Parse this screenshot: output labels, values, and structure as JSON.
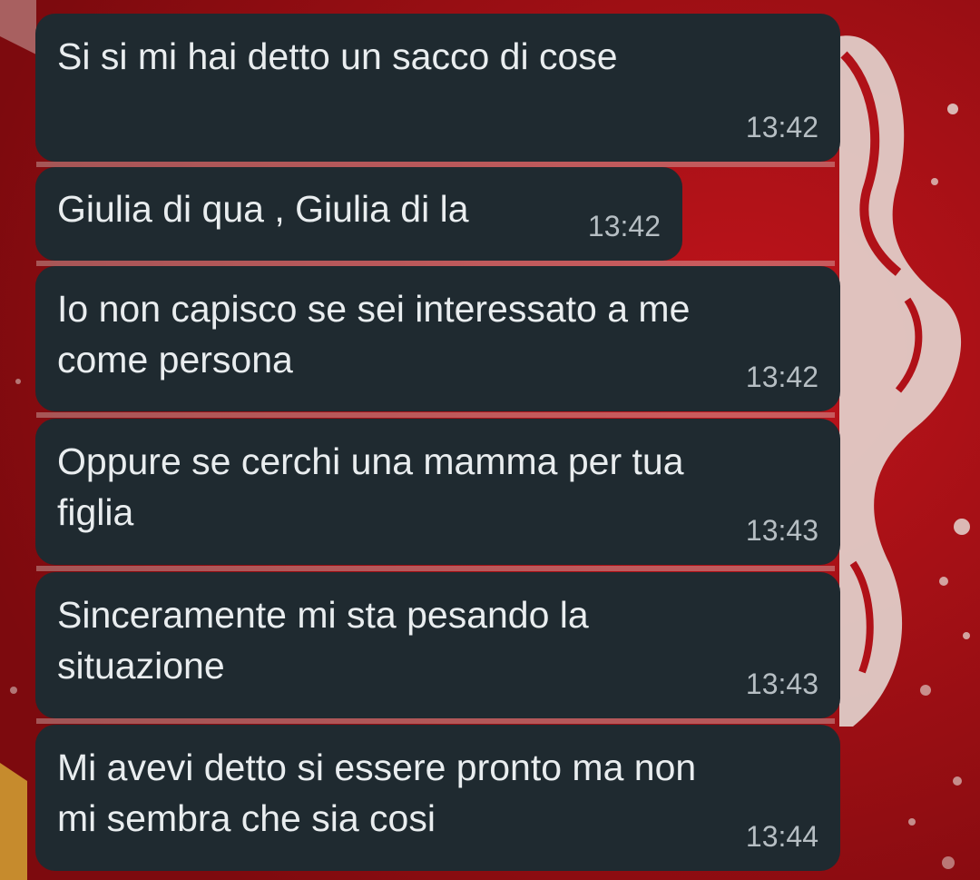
{
  "wallpaper": {
    "base_color": "#9e0d12",
    "accent_color": "#e8e2dc"
  },
  "bubble_style": {
    "background": "#1f2a30",
    "text_color": "#e9edef",
    "time_color": "#b6bec3"
  },
  "messages": [
    {
      "text": "Si si mi hai detto un sacco di cose",
      "time": "13:42"
    },
    {
      "text": "Giulia di qua , Giulia di la",
      "time": "13:42"
    },
    {
      "text": "Io non capisco se sei interessato a me\ncome persona",
      "time": "13:42"
    },
    {
      "text": "Oppure se cerchi una mamma per tua\nfiglia",
      "time": "13:43"
    },
    {
      "text": "Sinceramente mi sta pesando la\nsituazione",
      "time": "13:43"
    },
    {
      "text": "Mi avevi detto si essere pronto ma non\nmi sembra che sia cosi",
      "time": "13:44"
    }
  ]
}
